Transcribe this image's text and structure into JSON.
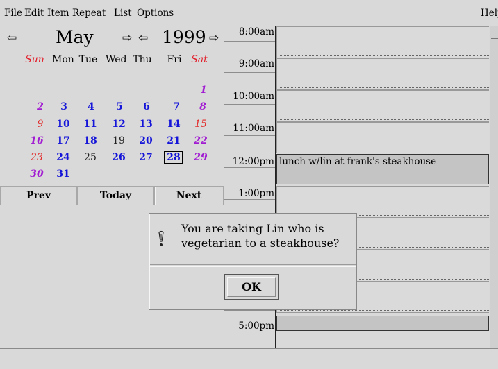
{
  "menu": [
    "File",
    "Edit",
    "Item",
    "Repeat",
    "List",
    "Options",
    "Help"
  ],
  "nav": {
    "month": "May",
    "year": "1999"
  },
  "calendar": {
    "weekdays": [
      "Sun",
      "Mon",
      "Tue",
      "Wed",
      "Thu",
      "Fri",
      "Sat"
    ],
    "weeks": [
      [
        "",
        "",
        "",
        "",
        "",
        "",
        "1"
      ],
      [
        "2",
        "3",
        "4",
        "5",
        "6",
        "7",
        "8"
      ],
      [
        "9",
        "10",
        "11",
        "12",
        "13",
        "14",
        "15"
      ],
      [
        "16",
        "17",
        "18",
        "19",
        "20",
        "21",
        "22"
      ],
      [
        "23",
        "24",
        "25",
        "26",
        "27",
        "28",
        "29"
      ],
      [
        "30",
        "31",
        "",
        "",
        "",
        "",
        ""
      ]
    ],
    "selected": "28",
    "colors": {
      "weekday_blue": "#1515d9",
      "sunday_red": "#e21d2a",
      "purple": "#a11bd2"
    }
  },
  "buttons": {
    "prev": "Prev",
    "today": "Today",
    "next": "Next"
  },
  "times": [
    "8:00am",
    "9:00am",
    "10:00am",
    "11:00am",
    "12:00pm",
    "1:00pm",
    "5:00pm"
  ],
  "event": {
    "text": "lunch w/lin at frank's steakhouse"
  },
  "dialog": {
    "message_line1": "You are taking Lin who is",
    "message_line2": "vegetarian to a steakhouse?",
    "ok_label": "OK",
    "icon": "exclamation-icon"
  }
}
